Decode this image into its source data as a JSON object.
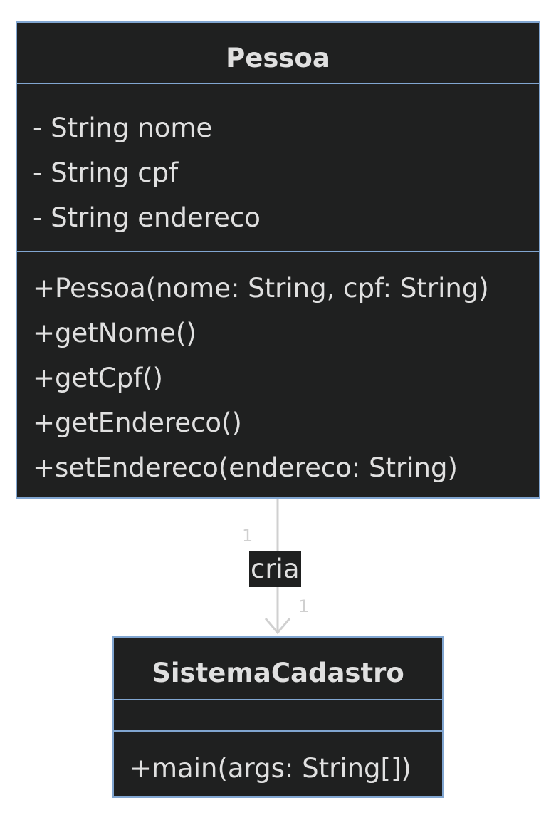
{
  "colors": {
    "class_fill": "#1f2020",
    "class_border": "#81a6d1",
    "text": "#e0e0e0",
    "edge": "#d0d0d0"
  },
  "classes": [
    {
      "name": "Pessoa",
      "attributes": [
        "- String nome",
        "- String cpf",
        "- String endereco"
      ],
      "methods": [
        "+Pessoa(nome: String, cpf: String)",
        "+getNome()",
        "+getCpf()",
        "+getEndereco()",
        "+setEndereco(endereco: String)"
      ]
    },
    {
      "name": "SistemaCadastro",
      "attributes": [],
      "methods": [
        "+main(args: String[])"
      ]
    }
  ],
  "relation": {
    "from": "Pessoa",
    "to": "SistemaCadastro",
    "label": "cria",
    "from_multiplicity": "1",
    "to_multiplicity": "1",
    "arrow": "open-arrow"
  }
}
